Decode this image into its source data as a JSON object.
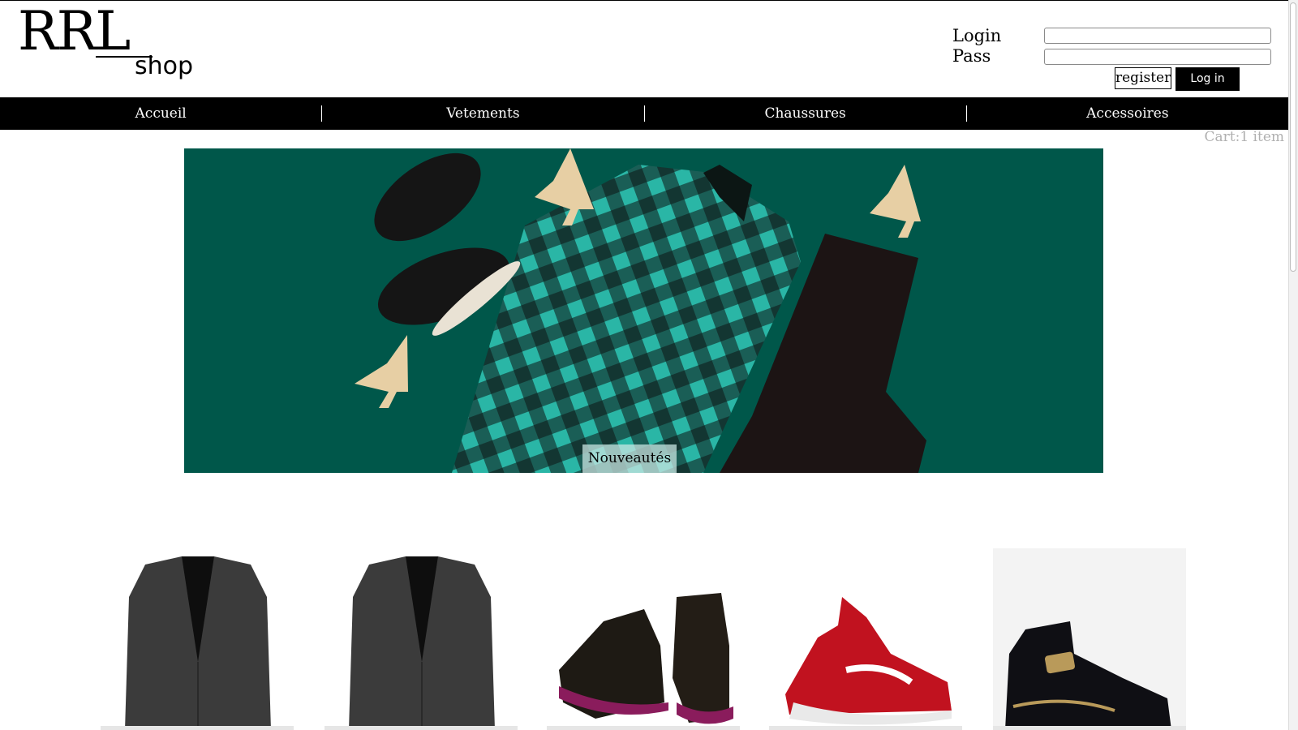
{
  "logo": {
    "main": "RRL",
    "sub": "shop"
  },
  "login": {
    "login_label": "Login",
    "pass_label": "Pass",
    "login_value": "",
    "pass_value": "",
    "register_label": "register",
    "login_button": "Log in"
  },
  "nav": {
    "items": [
      "Accueil",
      "Vetements",
      "Chaussures",
      "Accessoires"
    ]
  },
  "cart": "Cart:1 item",
  "banner": {
    "caption": "Nouveautés"
  },
  "products": [
    {
      "icon": "blazer-image"
    },
    {
      "icon": "blazer-image"
    },
    {
      "icon": "sneakers-image"
    },
    {
      "icon": "basketball-shoe-image"
    },
    {
      "icon": "high-top-sneaker-image"
    }
  ],
  "colors": {
    "navbar": "#000000",
    "banner_bg": "#00574a",
    "accent_plaid": "#2ab6a6"
  }
}
